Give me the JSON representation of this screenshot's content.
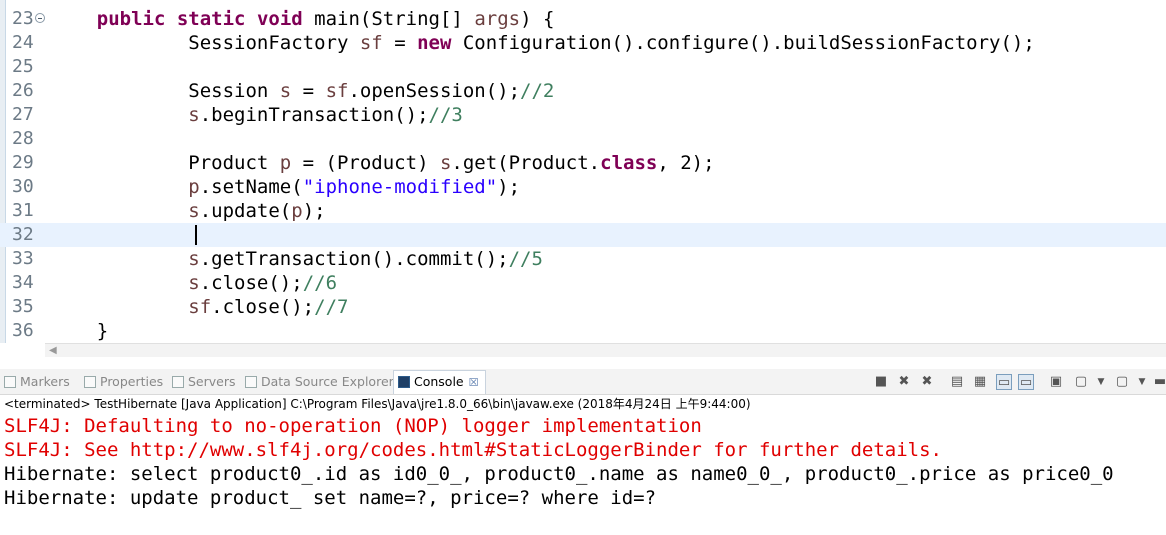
{
  "editor": {
    "lines": [
      {
        "num": "23",
        "parts": [
          {
            "t": "    "
          },
          {
            "t": "public",
            "c": "kw"
          },
          {
            "t": " "
          },
          {
            "t": "static",
            "c": "kw"
          },
          {
            "t": " "
          },
          {
            "t": "void",
            "c": "kw"
          },
          {
            "t": " main(String[] "
          },
          {
            "t": "args",
            "c": "var"
          },
          {
            "t": ") {"
          }
        ]
      },
      {
        "num": "24",
        "parts": [
          {
            "t": "            SessionFactory "
          },
          {
            "t": "sf",
            "c": "var"
          },
          {
            "t": " = "
          },
          {
            "t": "new",
            "c": "kw"
          },
          {
            "t": " Configuration().configure().buildSessionFactory();"
          }
        ]
      },
      {
        "num": "25",
        "parts": []
      },
      {
        "num": "26",
        "parts": [
          {
            "t": "            Session "
          },
          {
            "t": "s",
            "c": "var"
          },
          {
            "t": " = "
          },
          {
            "t": "sf",
            "c": "var"
          },
          {
            "t": ".openSession();"
          },
          {
            "t": "//2",
            "c": "com"
          }
        ]
      },
      {
        "num": "27",
        "parts": [
          {
            "t": "            "
          },
          {
            "t": "s",
            "c": "var"
          },
          {
            "t": ".beginTransaction();"
          },
          {
            "t": "//3",
            "c": "com"
          }
        ]
      },
      {
        "num": "28",
        "parts": []
      },
      {
        "num": "29",
        "parts": [
          {
            "t": "            Product "
          },
          {
            "t": "p",
            "c": "var"
          },
          {
            "t": " = (Product) "
          },
          {
            "t": "s",
            "c": "var"
          },
          {
            "t": ".get(Product."
          },
          {
            "t": "class",
            "c": "kw"
          },
          {
            "t": ", 2);"
          }
        ]
      },
      {
        "num": "30",
        "parts": [
          {
            "t": "            "
          },
          {
            "t": "p",
            "c": "var"
          },
          {
            "t": ".setName("
          },
          {
            "t": "\"iphone-modified\"",
            "c": "str"
          },
          {
            "t": ");"
          }
        ]
      },
      {
        "num": "31",
        "parts": [
          {
            "t": "            "
          },
          {
            "t": "s",
            "c": "var"
          },
          {
            "t": ".update("
          },
          {
            "t": "p",
            "c": "var"
          },
          {
            "t": ");"
          }
        ]
      },
      {
        "num": "32",
        "parts": [],
        "current": true
      },
      {
        "num": "33",
        "parts": [
          {
            "t": "            "
          },
          {
            "t": "s",
            "c": "var"
          },
          {
            "t": ".getTransaction().commit();"
          },
          {
            "t": "//5",
            "c": "com"
          }
        ]
      },
      {
        "num": "34",
        "parts": [
          {
            "t": "            "
          },
          {
            "t": "s",
            "c": "var"
          },
          {
            "t": ".close();"
          },
          {
            "t": "//6",
            "c": "com"
          }
        ]
      },
      {
        "num": "35",
        "parts": [
          {
            "t": "            "
          },
          {
            "t": "sf",
            "c": "var"
          },
          {
            "t": ".close();"
          },
          {
            "t": "//7",
            "c": "com"
          }
        ]
      },
      {
        "num": "36",
        "parts": [
          {
            "t": "    }"
          }
        ]
      }
    ]
  },
  "views": {
    "tabs": [
      {
        "label": "Markers",
        "icon": "markers-icon",
        "active": false
      },
      {
        "label": "Properties",
        "icon": "properties-icon",
        "active": false
      },
      {
        "label": "Servers",
        "icon": "servers-icon",
        "active": false
      },
      {
        "label": "Data Source Explorer",
        "icon": "data-source-icon",
        "active": false
      },
      {
        "label": "Console",
        "icon": "console-icon",
        "active": true,
        "close": "☒"
      }
    ],
    "toolbar": [
      "terminate-icon",
      "remove-launch-icon",
      "remove-all-icon",
      "scroll-lock-icon",
      "word-wrap-icon",
      "show-stdout-icon",
      "show-stderr-icon",
      "pin-console-icon",
      "display-console-icon",
      "open-console-icon",
      "minimize-icon"
    ]
  },
  "console": {
    "status": "<terminated> TestHibernate [Java Application] C:\\Program Files\\Java\\jre1.8.0_66\\bin\\javaw.exe (2018年4月24日 上午9:44:00)",
    "lines": [
      {
        "text": "SLF4J: Defaulting to no-operation (NOP) logger implementation",
        "err": true
      },
      {
        "text": "SLF4J: See http://www.slf4j.org/codes.html#StaticLoggerBinder for further details.",
        "err": true
      },
      {
        "text": "Hibernate: select product0_.id as id0_0_, product0_.name as name0_0_, product0_.price as price0_0",
        "err": false
      },
      {
        "text": "Hibernate: update product_ set name=?, price=? where id=?",
        "err": false
      }
    ]
  },
  "colors": {
    "keyword": "#7f0055",
    "variable": "#6a3e3e",
    "comment": "#3f7f5f",
    "string": "#2a00ff",
    "error": "#e00000"
  }
}
